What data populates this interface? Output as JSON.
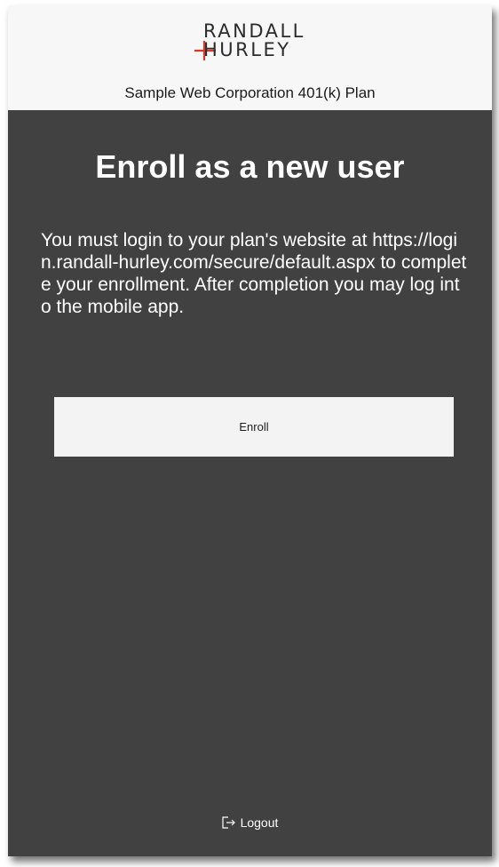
{
  "header": {
    "logo": {
      "line1": "RANDALL",
      "line2": "HURLEY"
    },
    "plan_name": "Sample Web Corporation 401(k) Plan"
  },
  "main": {
    "title": "Enroll as a new user",
    "message": "You must login to your plan's website at https://login.randall-hurley.com/secure/default.aspx to complete your enrollment. After completion you may log into the mobile app.",
    "enroll_label": "Enroll"
  },
  "footer": {
    "logout_label": "Logout"
  },
  "colors": {
    "background": "#414141",
    "header_background": "#f7f7f7",
    "logo_accent": "#d9382c",
    "button_background": "#f3f3f3"
  }
}
